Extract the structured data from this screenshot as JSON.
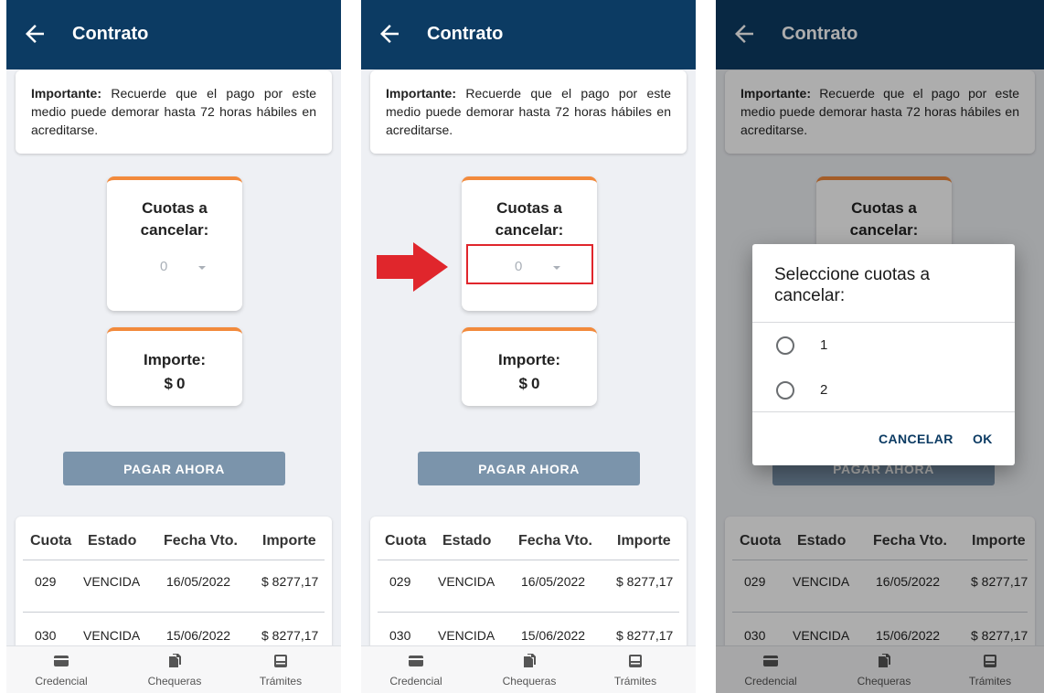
{
  "screen": {
    "title": "Contrato",
    "notice": {
      "bold": "Importante:",
      "text": " Recuerde que el pago por este medio puede demorar hasta 72 horas hábiles en acreditarse."
    },
    "cuotas_card": {
      "title": "Cuotas a cancelar:",
      "selected": "0"
    },
    "importe_card": {
      "title": "Importe:",
      "currency": "$",
      "amount": "0"
    },
    "pay_button": "PAGAR AHORA",
    "table": {
      "headers": [
        "Cuota",
        "Estado",
        "Fecha Vto.",
        "Importe"
      ],
      "rows": [
        [
          "029",
          "VENCIDA",
          "16/05/2022",
          "$ 8277,17"
        ],
        [
          "030",
          "VENCIDA",
          "15/06/2022",
          "$ 8277,17"
        ]
      ]
    },
    "nav": [
      {
        "label": "Credencial",
        "icon": "card-icon"
      },
      {
        "label": "Chequeras",
        "icon": "documents-icon"
      },
      {
        "label": "Trámites",
        "icon": "inbox-icon"
      }
    ]
  },
  "dialog": {
    "title": "Seleccione cuotas a cancelar:",
    "options": [
      "1",
      "2"
    ],
    "cancel": "CANCELAR",
    "ok": "OK"
  },
  "colors": {
    "appbar": "#0c3b63",
    "card_accent": "#f28a3c",
    "pay_button": "#7b94ab",
    "highlight": "#e0262c",
    "background": "#eef0f4"
  }
}
